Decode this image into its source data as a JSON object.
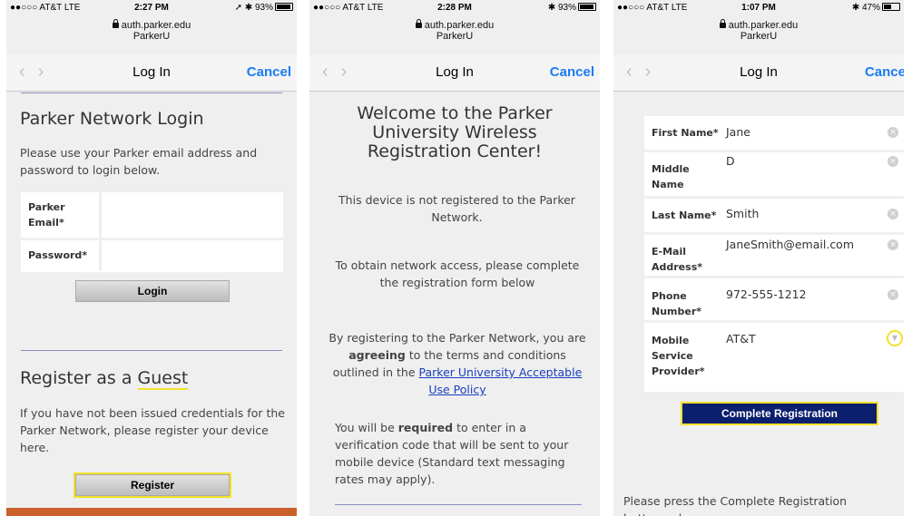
{
  "screens": [
    {
      "status": {
        "carrier": "●●○○○ AT&T  LTE",
        "time": "2:27 PM",
        "battery": "93%",
        "extra": "➚ ✱"
      },
      "url": {
        "domain": "auth.parker.edu",
        "site": "ParkerU"
      },
      "nav": {
        "title": "Log In",
        "cancel": "Cancel"
      },
      "login": {
        "heading": "Parker Network Login",
        "intro": "Please use your Parker email address and password to login below.",
        "email_label": "Parker Email*",
        "password_label": "Password*",
        "email_value": "",
        "password_value": "",
        "login_button": "Login"
      },
      "guest": {
        "heading_prefix": "Register as a ",
        "heading_highlight": "Guest",
        "text": "If you have not been issued credentials for the Parker Network, please register your device here.",
        "register_button": "Register"
      }
    },
    {
      "status": {
        "carrier": "●●○○○ AT&T  LTE",
        "time": "2:28 PM",
        "battery": "93%",
        "extra": "✱"
      },
      "url": {
        "domain": "auth.parker.edu",
        "site": "ParkerU"
      },
      "nav": {
        "title": "Log In",
        "cancel": "Cancel"
      },
      "welcome": {
        "heading": "Welcome to the Parker University Wireless Registration Center!",
        "p1": "This device is not registered to the Parker Network.",
        "p2": "To obtain network access, please complete the registration form below",
        "p3_a": "By registering to the Parker Network, you are ",
        "p3_b": "agreeing",
        "p3_c": " to the terms and conditions outlined in the ",
        "p3_link": "Parker University Acceptable Use Policy",
        "p4_a": "You will be ",
        "p4_b": "required",
        "p4_c": " to enter in a verification code that will be sent to your mobile device (Standard text messaging rates may apply)."
      }
    },
    {
      "status": {
        "carrier": "●●○○○ AT&T  LTE",
        "time": "1:07 PM",
        "battery": "47%",
        "extra": "✱"
      },
      "url": {
        "domain": "auth.parker.edu",
        "site": "ParkerU"
      },
      "nav": {
        "title": "Log In",
        "cancel": "Cance"
      },
      "form": {
        "fields": [
          {
            "label": "First Name*",
            "value": "Jane"
          },
          {
            "label": "Middle Name",
            "value": "D"
          },
          {
            "label": "Last Name*",
            "value": "Smith"
          },
          {
            "label": "E-Mail Address*",
            "value": "JaneSmith@email.com"
          },
          {
            "label": "Phone Number*",
            "value": "972-555-1212"
          },
          {
            "label": "Mobile Service Provider*",
            "value": "AT&T"
          }
        ],
        "submit_button": "Complete Registration",
        "note": "Please press the Complete Registration button only once."
      }
    }
  ],
  "colors": {
    "accent_highlight": "#f2e12a",
    "nav_blue": "#1a7cf4",
    "submit_bg": "#0b1f6e",
    "footer_orange": "#c8612a"
  }
}
